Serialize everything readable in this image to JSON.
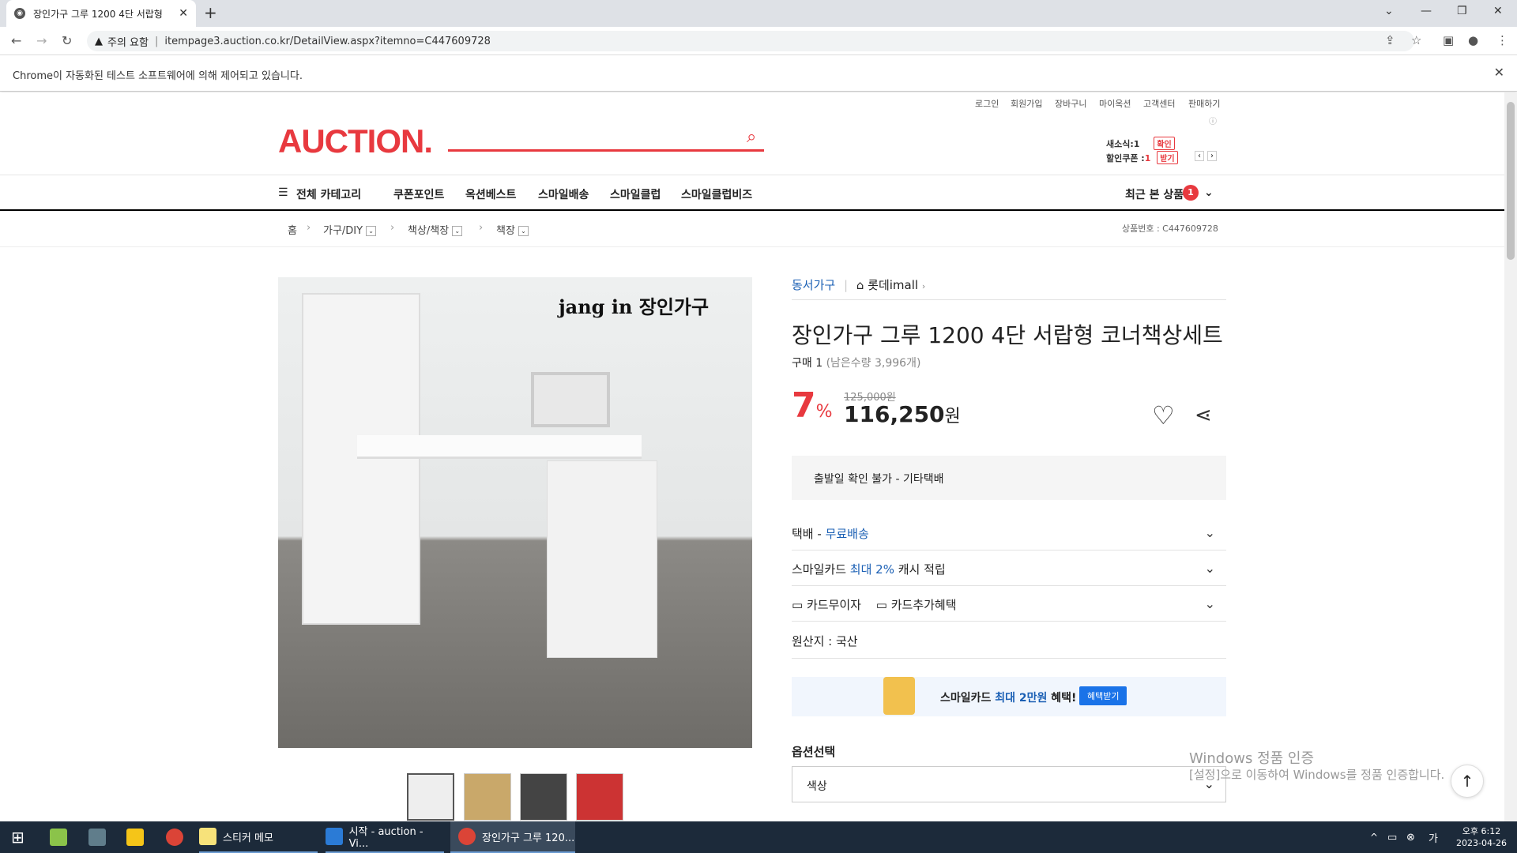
{
  "browser": {
    "tab_title": "장인가구 그루 1200 4단 서랍형",
    "security_label": "주의 요함",
    "url": "itempage3.auction.co.kr/DetailView.aspx?itemno=C447609728",
    "infobar_message": "Chrome이 자동화된 테스트 소프트웨어에 의해 제어되고 있습니다."
  },
  "header": {
    "logo": "AUCTION.",
    "util_links": [
      "로그인",
      "회원가입",
      "장바구니",
      "마이옥션",
      "고객센터",
      "판매하기"
    ],
    "alarm_label": "새소식:",
    "alarm_count": "1",
    "alarm_btn": "확인",
    "coupon_label": "할인쿠폰 :",
    "coupon_count": "1",
    "coupon_btn": "받기"
  },
  "gnb": {
    "category": "전체 카테고리",
    "items": [
      "쿠폰포인트",
      "옥션베스트",
      "스마일배송",
      "스마일클럽",
      "스마일클럽비즈"
    ],
    "recent": "최근 본 상품",
    "recent_count": "1"
  },
  "breadcrumb": {
    "home": "홈",
    "items": [
      "가구/DIY",
      "책상/책장",
      "책장"
    ],
    "product_no": "상품번호 : C447609728"
  },
  "product": {
    "brand_text": "jang in 장인가구",
    "seller": "동서가구",
    "store": "롯데imall",
    "title": "장인가구 그루 1200 4단 서랍형 코너책상세트",
    "purchase": "구매 1",
    "stock": "(남은수량 3,996개)",
    "discount": "7",
    "discount_unit": "%",
    "original_price": "125,000원",
    "price": "116,250",
    "price_unit": "원",
    "shipping_notice": "출발일 확인 불가 - 기타택배",
    "delivery_label": "택배 - ",
    "delivery_value": "무료배송",
    "card_prefix": "스마일카드 ",
    "card_highlight": "최대 2%",
    "card_suffix": " 캐시 적립",
    "installment": "카드무이자",
    "card_benefit": "카드추가혜택",
    "origin": "원산지 : 국산",
    "banner_prefix": "스마일카드 ",
    "banner_highlight": "최대 2만원",
    "banner_suffix": " 혜택!",
    "banner_btn": "혜택받기",
    "option_title": "옵션선택",
    "option_placeholder": "색상"
  },
  "watermark": {
    "line1": "Windows 정품 인증",
    "line2": "[설정]으로 이동하여 Windows를 정품 인증합니다."
  },
  "taskbar": {
    "apps": [
      "스티커 메모",
      "시작 - auction - Vi...",
      "장인가구 그루 120..."
    ],
    "time": "오후 6:12",
    "date": "2023-04-26"
  },
  "colors": {
    "accent": "#e8393f",
    "link_blue": "#1a5fb4",
    "taskbar": "#1c2a3a"
  }
}
